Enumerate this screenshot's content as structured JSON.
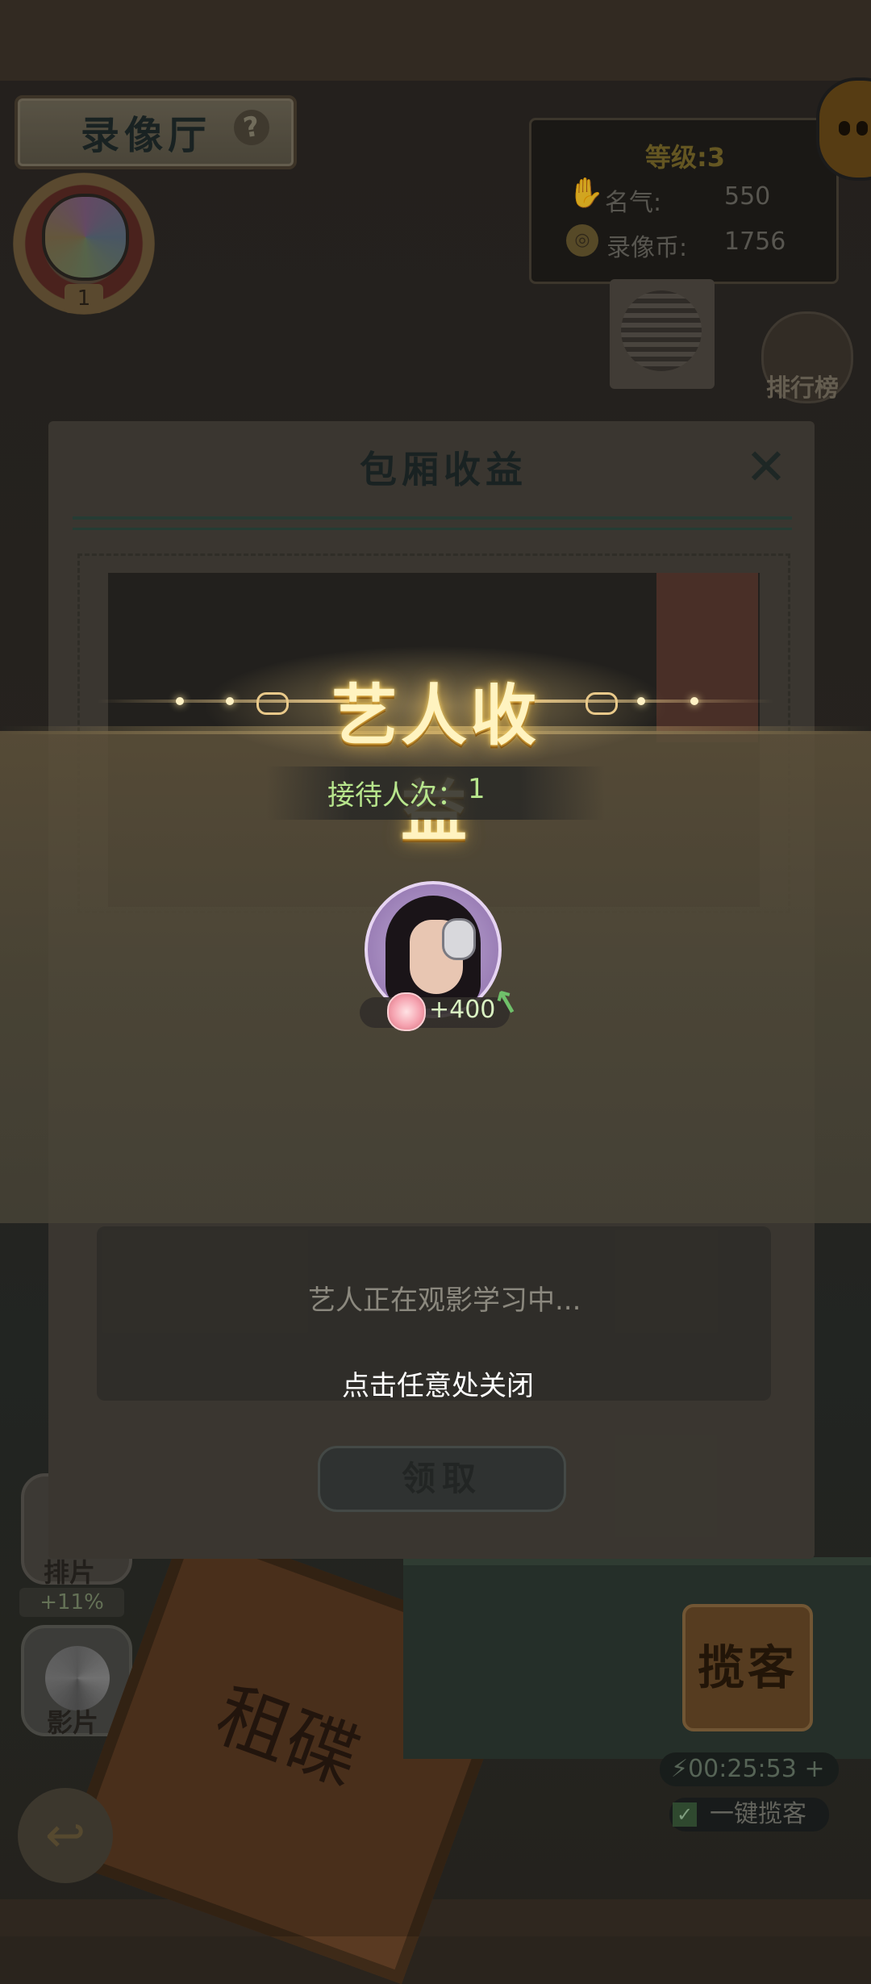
{
  "hall": {
    "title": "录像厅",
    "help_icon": "?",
    "badge_rank": "1"
  },
  "stats": {
    "level": "等级:3",
    "fame_label": "名气:",
    "fame_value": "550",
    "coin_label": "录像币:",
    "coin_value": "1756"
  },
  "ranking": {
    "label": "排行榜"
  },
  "left_buttons": {
    "schedule_label": "排片",
    "schedule_bonus": "+11%",
    "films_label": "影片"
  },
  "sign": {
    "text": "租碟"
  },
  "tout": {
    "button_label": "揽客",
    "timer": "00:25:53",
    "timer_plus": "+",
    "auto_label": "一键揽客",
    "auto_checked": "✓"
  },
  "dialog": {
    "title": "包厢收益",
    "close": "✕",
    "status": "艺人正在观影学习中...",
    "collect_label": "领取"
  },
  "earnings_overlay": {
    "title": "艺人收益",
    "visits_label": "接待人次：",
    "visits_value": "1",
    "gain_value": "+400",
    "close_hint": "点击任意处关闭"
  },
  "colors": {
    "title_gold": "#fff3c0",
    "visits_green": "#b7e58c",
    "gain_green": "#6fc06a"
  },
  "icons": {
    "help": "question-mark-icon",
    "fame": "hand-icon",
    "coin": "film-coin-icon",
    "back": "back-arrow-icon",
    "close": "close-icon",
    "gain_arrow": "up-arrow-icon",
    "gift": "flower-icon",
    "lightning": "lightning-icon"
  }
}
